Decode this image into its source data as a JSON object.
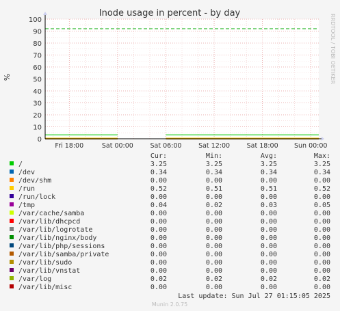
{
  "chart_data": {
    "type": "line",
    "title": "Inode usage in percent - by day",
    "ylabel": "%",
    "side_label": "RRDTOOL / TOBI OETIKER",
    "ylim": [
      0,
      100
    ],
    "y_ticks": [
      0,
      10,
      20,
      30,
      40,
      50,
      60,
      70,
      80,
      90,
      100
    ],
    "x_ticks": [
      "Fri 18:00",
      "Sat 00:00",
      "Sat 06:00",
      "Sat 12:00",
      "Sat 18:00",
      "Sun 00:00"
    ],
    "x_range_hours": [
      -3,
      31
    ],
    "x_tick_hours": [
      0,
      6,
      12,
      18,
      24,
      30
    ],
    "warning_line": 92,
    "series_segments": [
      [
        -3,
        6
      ],
      [
        12,
        31
      ]
    ],
    "legend_headers": [
      "Cur:",
      "Min:",
      "Avg:",
      "Max:"
    ],
    "series": [
      {
        "name": "/",
        "color": "#00cc00",
        "cur": "3.25",
        "min": "3.25",
        "avg": "3.25",
        "max": "3.25"
      },
      {
        "name": "/dev",
        "color": "#0066b3",
        "cur": "0.34",
        "min": "0.34",
        "avg": "0.34",
        "max": "0.34"
      },
      {
        "name": "/dev/shm",
        "color": "#ff8000",
        "cur": "0.00",
        "min": "0.00",
        "avg": "0.00",
        "max": "0.00"
      },
      {
        "name": "/run",
        "color": "#ffcc00",
        "cur": "0.52",
        "min": "0.51",
        "avg": "0.51",
        "max": "0.52"
      },
      {
        "name": "/run/lock",
        "color": "#330099",
        "cur": "0.00",
        "min": "0.00",
        "avg": "0.00",
        "max": "0.00"
      },
      {
        "name": "/tmp",
        "color": "#990099",
        "cur": "0.04",
        "min": "0.02",
        "avg": "0.03",
        "max": "0.05"
      },
      {
        "name": "/var/cache/samba",
        "color": "#ccff00",
        "cur": "0.00",
        "min": "0.00",
        "avg": "0.00",
        "max": "0.00"
      },
      {
        "name": "/var/lib/dhcpcd",
        "color": "#ff0000",
        "cur": "0.00",
        "min": "0.00",
        "avg": "0.00",
        "max": "0.00"
      },
      {
        "name": "/var/lib/logrotate",
        "color": "#808080",
        "cur": "0.00",
        "min": "0.00",
        "avg": "0.00",
        "max": "0.00"
      },
      {
        "name": "/var/lib/nginx/body",
        "color": "#008f00",
        "cur": "0.00",
        "min": "0.00",
        "avg": "0.00",
        "max": "0.00"
      },
      {
        "name": "/var/lib/php/sessions",
        "color": "#00487d",
        "cur": "0.00",
        "min": "0.00",
        "avg": "0.00",
        "max": "0.00"
      },
      {
        "name": "/var/lib/samba/private",
        "color": "#b35a00",
        "cur": "0.00",
        "min": "0.00",
        "avg": "0.00",
        "max": "0.00"
      },
      {
        "name": "/var/lib/sudo",
        "color": "#b38f00",
        "cur": "0.00",
        "min": "0.00",
        "avg": "0.00",
        "max": "0.00"
      },
      {
        "name": "/var/lib/vnstat",
        "color": "#6b006b",
        "cur": "0.00",
        "min": "0.00",
        "avg": "0.00",
        "max": "0.00"
      },
      {
        "name": "/var/log",
        "color": "#8fb300",
        "cur": "0.02",
        "min": "0.02",
        "avg": "0.02",
        "max": "0.02"
      },
      {
        "name": "/var/lib/misc",
        "color": "#b30000",
        "cur": "0.00",
        "min": "0.00",
        "avg": "0.00",
        "max": "0.00"
      }
    ],
    "last_update": "Last update: Sun Jul 27 01:15:05 2025",
    "footer": "Munin 2.0.75"
  }
}
